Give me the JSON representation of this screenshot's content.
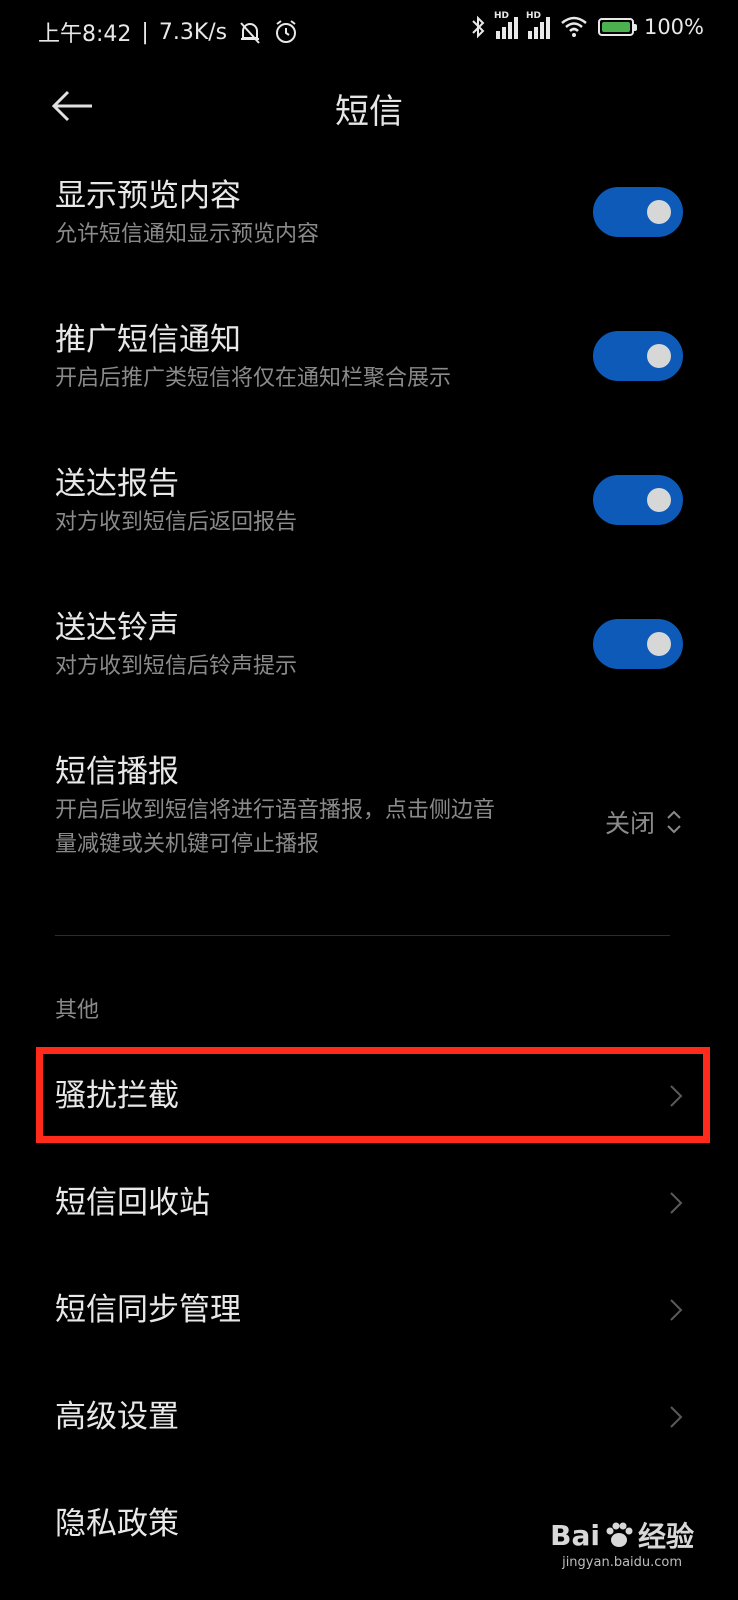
{
  "status_bar": {
    "time": "上午8:42",
    "speed": "7.3K/s",
    "hd1": "HD",
    "hd2": "HD",
    "battery": "100%",
    "battery_level": 1.0
  },
  "header": {
    "title": "短信"
  },
  "settings": [
    {
      "title": "显示预览内容",
      "subtitle": "允许短信通知显示预览内容",
      "on": true
    },
    {
      "title": "推广短信通知",
      "subtitle": "开启后推广类短信将仅在通知栏聚合展示",
      "on": true
    },
    {
      "title": "送达报告",
      "subtitle": "对方收到短信后返回报告",
      "on": true
    },
    {
      "title": "送达铃声",
      "subtitle": "对方收到短信后铃声提示",
      "on": true
    }
  ],
  "broadcast": {
    "title": "短信播报",
    "subtitle_line1": "开启后收到短信将进行语音播报，点击侧边音",
    "subtitle_line2": "量减键或关机键可停止播报",
    "value": "关闭"
  },
  "section_other": "其他",
  "links": [
    {
      "label": "骚扰拦截"
    },
    {
      "label": "短信回收站"
    },
    {
      "label": "短信同步管理"
    },
    {
      "label": "高级设置"
    },
    {
      "label": "隐私政策"
    }
  ],
  "watermark": {
    "brand": "Bai",
    "brand_suffix": "经验",
    "url": "jingyan.baidu.com"
  },
  "colors": {
    "toggle_on": "#0d5ab8",
    "highlight": "#ff2b1a",
    "background": "#000000"
  }
}
